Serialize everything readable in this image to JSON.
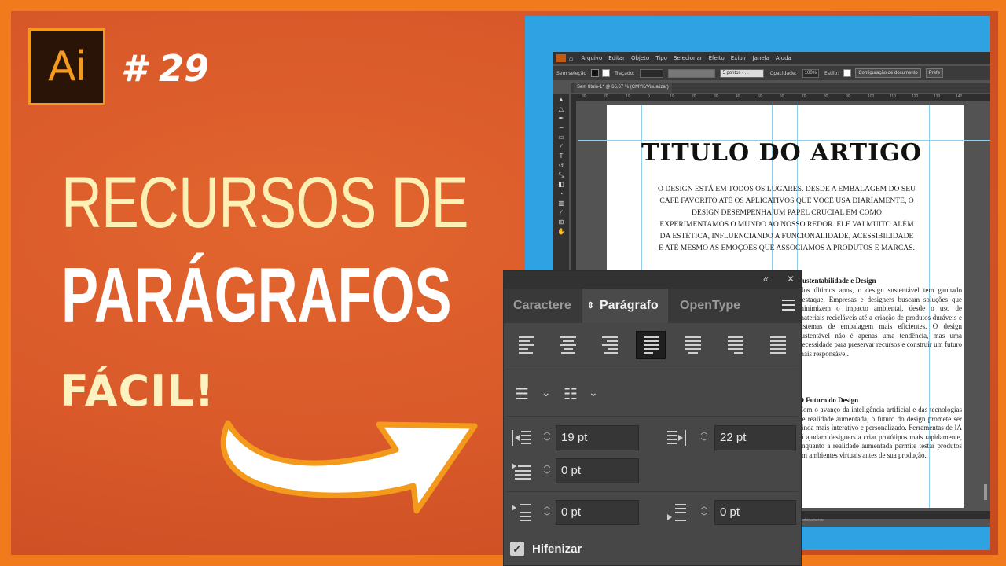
{
  "thumbnail": {
    "logo_text": "Ai",
    "episode": "# 29",
    "title_line1": "RECURSOS DE",
    "title_line2": "PARÁGRAFOS",
    "tagline": "FÁCIL!",
    "colors": {
      "background": "#d9592a",
      "frame": "#f07a1c",
      "title1": "#fdf0b5",
      "panel_blue": "#2fa2e3"
    }
  },
  "illustrator": {
    "menu": [
      "Arquivo",
      "Editar",
      "Objeto",
      "Tipo",
      "Selecionar",
      "Efeito",
      "Exibir",
      "Janela",
      "Ajuda"
    ],
    "control_bar": {
      "selection": "Sem seleção",
      "stroke_label": "Traçado:",
      "brush": "5 pontos - ...",
      "opacity_label": "Opacidade:",
      "opacity_value": "100%",
      "style_label": "Estilo:",
      "doc_setup_button": "Configuração de documento",
      "prefs_button": "Prefe"
    },
    "document_tab": "Sem título-1* @ 66,67 % (CMYK/Visualizar)",
    "ruler_marks": [
      "30",
      "20",
      "10",
      "0",
      "10",
      "20",
      "30",
      "40",
      "50",
      "60",
      "70",
      "80",
      "90",
      "100",
      "110",
      "120",
      "130",
      "140"
    ],
    "status_text": "Inteiramente",
    "artboard": {
      "title": "TITULO DO ARTIGO",
      "intro": "O DESIGN ESTÁ EM TODOS OS LUGARES. DESDE A EMBALAGEM DO SEU CAFÉ FAVORITO ATÉ OS APLICATIVOS QUE VOCÊ USA DIARIAMENTE, O DESIGN DESEMPENHA UM PAPEL CRUCIAL EM COMO EXPERIMENTAMOS O MUNDO AO NOSSO REDOR. ELE VAI MUITO ALÉM DA ESTÉTICA, INFLUENCIANDO A FUNCIONALIDADE, ACESSIBILIDADE E ATÉ MESMO AS EMOÇÕES QUE ASSOCIAMOS A PRODUTOS E MARCAS.",
      "section1_heading": "Sustentabilidade e Design",
      "section1_text": "Nos últimos anos, o design sustentável tem ganhado destaque. Empresas e designers buscam soluções que minimizem o impacto ambiental, desde o uso de materiais recicláveis até a criação de produtos duráveis e sistemas de embalagem mais eficientes. O design sustentável não é apenas uma tendência, mas uma necessidade para preservar recursos e construir um futuro mais responsável.",
      "section2_heading": "O Futuro do Design",
      "section2_text": "Com o avanço da inteligência artificial e das tecnologias de realidade aumentada, o futuro do design promete ser ainda mais interativo e personalizado. Ferramentas de IA já ajudam designers a criar protótipos mais rapidamente, enquanto a realidade aumentada permite testar produtos em ambientes virtuais antes de sua produção."
    }
  },
  "paragraph_panel": {
    "collapse_icon": "«",
    "close_icon": "✕",
    "tabs": [
      "Caractere",
      "Parágrafo",
      "OpenType"
    ],
    "active_tab": "Parágrafo",
    "alignment_active": "justify-last-left",
    "left_indent": "19 pt",
    "right_indent": "22 pt",
    "first_line_indent": "0 pt",
    "space_before": "0 pt",
    "space_after": "0 pt",
    "hyphenate_label": "Hifenizar",
    "hyphenate_checked": true
  }
}
